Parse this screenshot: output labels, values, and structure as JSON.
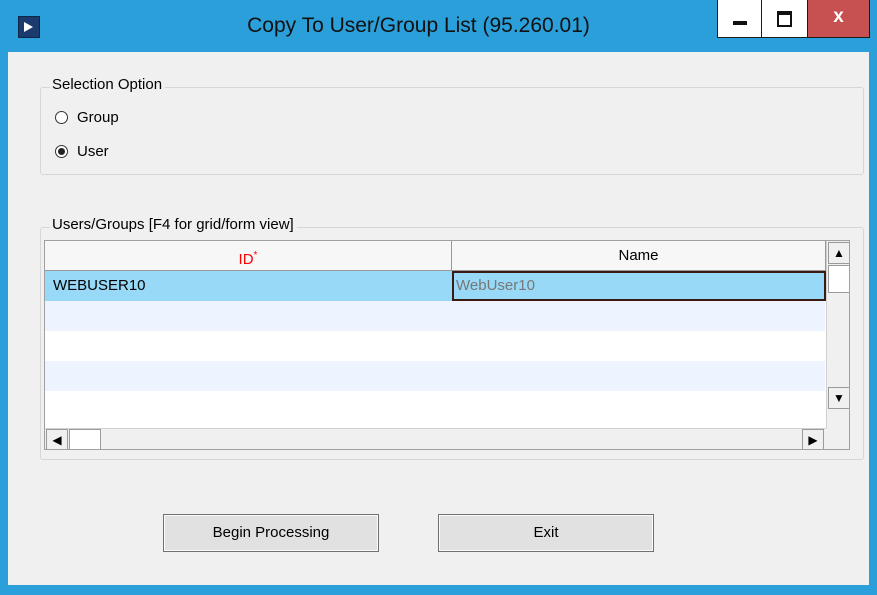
{
  "window": {
    "title": "Copy To User/Group List (95.260.01)",
    "controls": {
      "minimize": "minimize",
      "maximize": "maximize",
      "close": "x"
    },
    "colors": {
      "titlebar": "#2b9fd9",
      "close_button": "#c75050"
    }
  },
  "selection_option": {
    "label": "Selection Option",
    "options": [
      {
        "label": "Group",
        "checked": false
      },
      {
        "label": "User",
        "checked": true
      }
    ]
  },
  "users_groups": {
    "label": "Users/Groups [F4 for grid/form view]",
    "columns": [
      {
        "label": "ID",
        "required_mark": "*"
      },
      {
        "label": "Name"
      }
    ],
    "rows": [
      {
        "id": "WEBUSER10",
        "name": "WebUser10",
        "selected": true
      }
    ],
    "colors": {
      "selected_row": "#99d9f8",
      "alt_row": "#eef4ff",
      "required_header": "#ff0000"
    }
  },
  "buttons": {
    "begin_processing": "Begin Processing",
    "exit": "Exit"
  }
}
